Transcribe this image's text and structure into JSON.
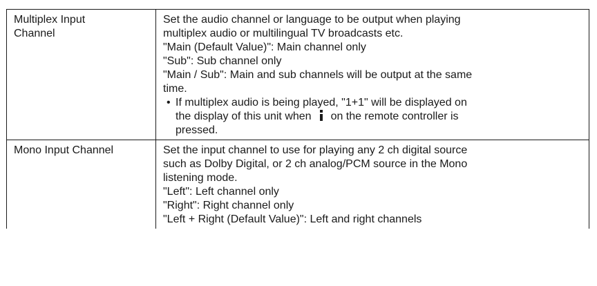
{
  "table": {
    "rows": [
      {
        "name": [
          "Multiplex Input",
          "Channel"
        ],
        "description": [
          "Set the audio channel or language to be output when playing",
          "multiplex audio or multilingual TV broadcasts etc.",
          "\"Main (Default Value)\": Main channel only",
          "\"Sub\": Sub channel only",
          "\"Main / Sub\": Main and sub channels will be output at the same",
          "time."
        ],
        "note": {
          "bullet": "•",
          "line1": "If multiplex audio is being played, \"1+1\" will be displayed on",
          "line2_before": "the display of this unit when",
          "icon": "info-icon",
          "line2_after": "on the remote controller is",
          "line3": "pressed."
        }
      },
      {
        "name": [
          "Mono Input Channel"
        ],
        "description": [
          "Set the input channel to use for playing any 2 ch digital source",
          "such as Dolby Digital, or 2 ch analog/PCM source in the Mono",
          "listening mode.",
          "\"Left\": Left channel only",
          "\"Right\": Right channel only",
          "\"Left + Right (Default Value)\": Left and right channels"
        ]
      }
    ]
  }
}
